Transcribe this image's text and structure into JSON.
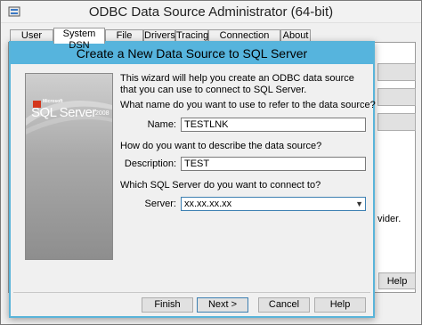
{
  "outer_window": {
    "title": "ODBC Data Source Administrator (64-bit)",
    "tabs": [
      {
        "label": "User DSN"
      },
      {
        "label": "System DSN"
      },
      {
        "label": "File DSN"
      },
      {
        "label": "Drivers"
      },
      {
        "label": "Tracing"
      },
      {
        "label": "Connection Pooling"
      },
      {
        "label": "About"
      }
    ],
    "active_tab": "System DSN",
    "partial_text": "vider.",
    "help_label": "Help"
  },
  "dialog": {
    "title": "Create a New Data Source to SQL Server",
    "logo": {
      "brand": "Microsoft",
      "product": "SQL Server",
      "year": "2008"
    },
    "intro_text": "This wizard will help you create an ODBC data source that you can use to connect to SQL Server.",
    "name_question": "What name do you want to use to refer to the data source?",
    "name_label": "Name:",
    "name_value": "TESTLNK",
    "description_question": "How do you want to describe the data source?",
    "description_label": "Description:",
    "description_value": "TEST",
    "server_question": "Which SQL Server do you want to connect to?",
    "server_label": "Server:",
    "server_value": "xx.xx.xx.xx",
    "buttons": {
      "finish": "Finish",
      "next": "Next >",
      "cancel": "Cancel",
      "help": "Help"
    }
  },
  "colors": {
    "dialog_titlebar": "#56b4dd",
    "window_bg": "#f0f0f0",
    "focus_border": "#3c7fb1"
  }
}
